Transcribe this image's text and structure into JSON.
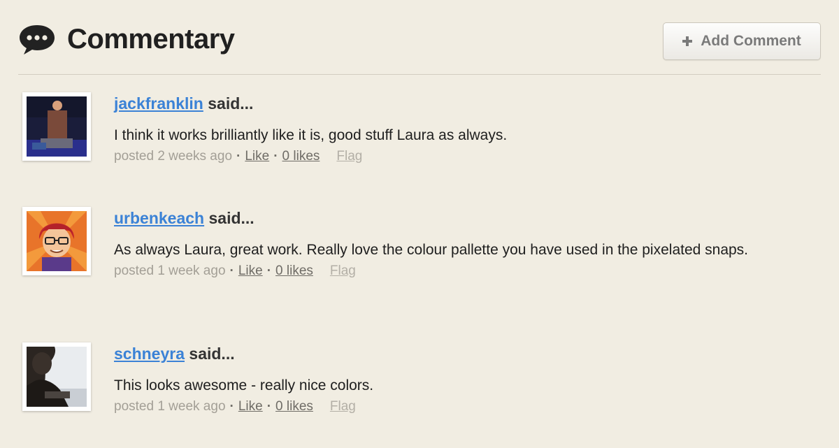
{
  "header": {
    "title": "Commentary",
    "icon": "speech-bubble-icon",
    "add_button_label": "Add Comment",
    "add_button_icon": "plus-icon"
  },
  "comments": [
    {
      "username": "jackfranklin",
      "said": "said...",
      "text": "I think it works brilliantly like it is, good stuff Laura as always.",
      "posted": "posted 2 weeks ago",
      "like_label": "Like",
      "likes_label": "0 likes",
      "flag_label": "Flag"
    },
    {
      "username": "urbenkeach",
      "said": "said...",
      "text": "As always Laura, great work. Really love the colour pallette you have used in the pixelated snaps.",
      "posted": "posted 1 week ago",
      "like_label": "Like",
      "likes_label": "0 likes",
      "flag_label": "Flag"
    },
    {
      "username": "schneyra",
      "said": "said...",
      "text": "This looks awesome - really nice colors.",
      "posted": "posted 1 week ago",
      "like_label": "Like",
      "likes_label": "0 likes",
      "flag_label": "Flag"
    }
  ],
  "colors": {
    "background": "#f1ede2",
    "link": "#3b82d6",
    "meta": "#a39f96"
  }
}
